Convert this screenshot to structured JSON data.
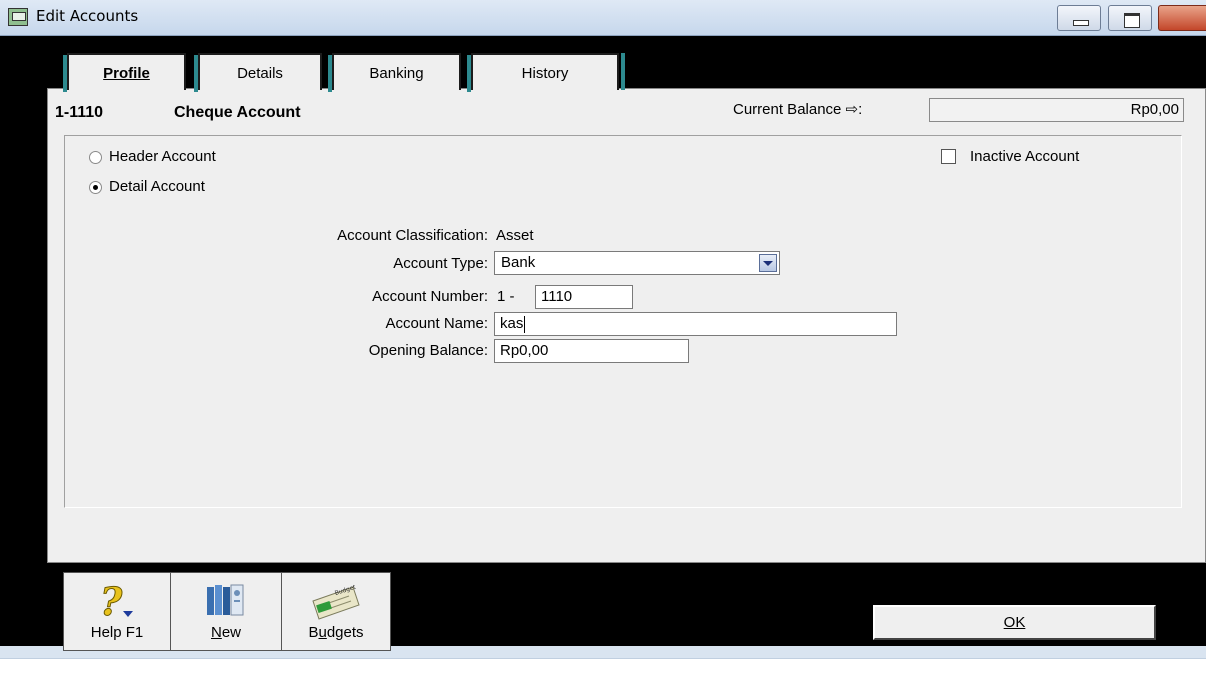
{
  "window": {
    "title": "Edit Accounts"
  },
  "tabs": [
    {
      "label": "Profile",
      "active": true
    },
    {
      "label": "Details"
    },
    {
      "label": "Banking"
    },
    {
      "label": "History"
    }
  ],
  "account": {
    "code": "1-1110",
    "title": "Cheque Account",
    "current_balance_label": "Current Balance ⇨:",
    "current_balance": "Rp0,00"
  },
  "options": {
    "header_account": "Header Account",
    "detail_account": "Detail Account",
    "selected": "detail_account",
    "inactive_account": "Inactive Account",
    "inactive_checked": false
  },
  "form": {
    "classification_label": "Account Classification:",
    "classification_value": "Asset",
    "type_label": "Account Type:",
    "type_value": "Bank",
    "number_label": "Account Number:",
    "number_prefix": "1 -",
    "number_value": "1110",
    "name_label": "Account Name:",
    "name_value": "kas",
    "opening_label": "Opening Balance:",
    "opening_value": "Rp0,00"
  },
  "toolbar": {
    "help_label": "Help F1",
    "new_label": "New",
    "budgets_label": "Budgets",
    "budget_icon_text": "Budget"
  },
  "ok_label": "OK"
}
